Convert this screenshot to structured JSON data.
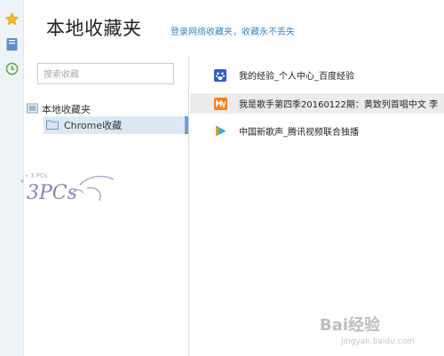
{
  "header": {
    "title": "本地收藏夹",
    "login_link": "登录网络收藏夹，收藏永不丢失"
  },
  "sidebar": {
    "search_placeholder": "搜索收藏",
    "root_label": "本地收藏夹",
    "child_label": "Chrome收藏"
  },
  "bookmarks": [
    {
      "title": "我的经验_个人中心_百度经验",
      "icon": "baidu-paw-icon",
      "selected": false
    },
    {
      "title": "我是歌手第四季20160122期：黄致列首唱中文 李",
      "icon": "mango-tv-icon",
      "selected": true
    },
    {
      "title": "中国新歌声_腾讯视频联合独播",
      "icon": "tencent-video-icon",
      "selected": false
    }
  ],
  "watermarks": {
    "baidu_text": "Bai经验",
    "baidu_url": "jingyan.baidu.com",
    "logo_text": "3PCs"
  },
  "colors": {
    "accent_link": "#3a86c8",
    "selection": "#dce9f5",
    "rail": "#eef3f8"
  }
}
